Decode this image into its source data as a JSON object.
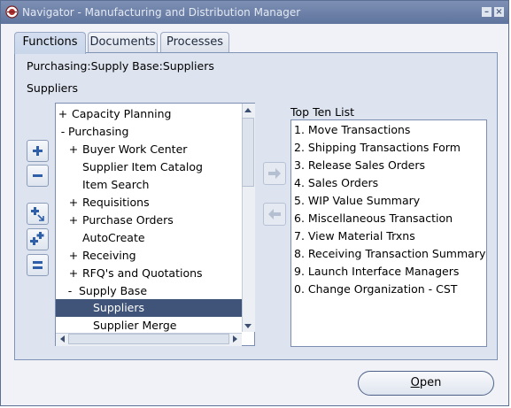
{
  "window": {
    "title": "Navigator - Manufacturing and Distribution Manager"
  },
  "tabs": [
    {
      "label": "Functions",
      "active": true
    },
    {
      "label": "Documents",
      "active": false
    },
    {
      "label": "Processes",
      "active": false
    }
  ],
  "breadcrumb": "Purchasing:Supply Base:Suppliers",
  "section_label": "Suppliers",
  "tree": {
    "rows": [
      {
        "exp": "+",
        "label": "Capacity Planning",
        "level": 0
      },
      {
        "exp": "-",
        "label": "Purchasing",
        "level": 0
      },
      {
        "exp": "+",
        "label": "Buyer Work Center",
        "level": 1
      },
      {
        "exp": "",
        "label": "Supplier Item Catalog",
        "level": 1
      },
      {
        "exp": "",
        "label": "Item Search",
        "level": 1
      },
      {
        "exp": "+",
        "label": "Requisitions",
        "level": 1
      },
      {
        "exp": "+",
        "label": "Purchase Orders",
        "level": 1
      },
      {
        "exp": "",
        "label": "AutoCreate",
        "level": 1
      },
      {
        "exp": "+",
        "label": "Receiving",
        "level": 1
      },
      {
        "exp": "+",
        "label": "RFQ's and Quotations",
        "level": 1
      },
      {
        "exp": "-",
        "label": "Supply Base",
        "level": 1
      },
      {
        "exp": "",
        "label": "Suppliers",
        "level": 2,
        "selected": true
      },
      {
        "exp": "",
        "label": "Supplier Merge",
        "level": 2
      }
    ]
  },
  "top_ten": {
    "label": "Top Ten List",
    "items": [
      "1. Move Transactions",
      "2. Shipping Transactions Form",
      "3. Release Sales Orders",
      "4. Sales Orders",
      "5. WIP Value Summary",
      "6. Miscellaneous Transaction",
      "7. View Material Trxns",
      "8. Receiving Transaction Summary",
      "9. Launch Interface Managers",
      "0. Change Organization - CST"
    ]
  },
  "open_button": {
    "mnemonic": "O",
    "rest": "pen"
  },
  "colors": {
    "selection": "#3f5478",
    "titlebar": "#5f759d",
    "panel": "#dde3ef"
  }
}
